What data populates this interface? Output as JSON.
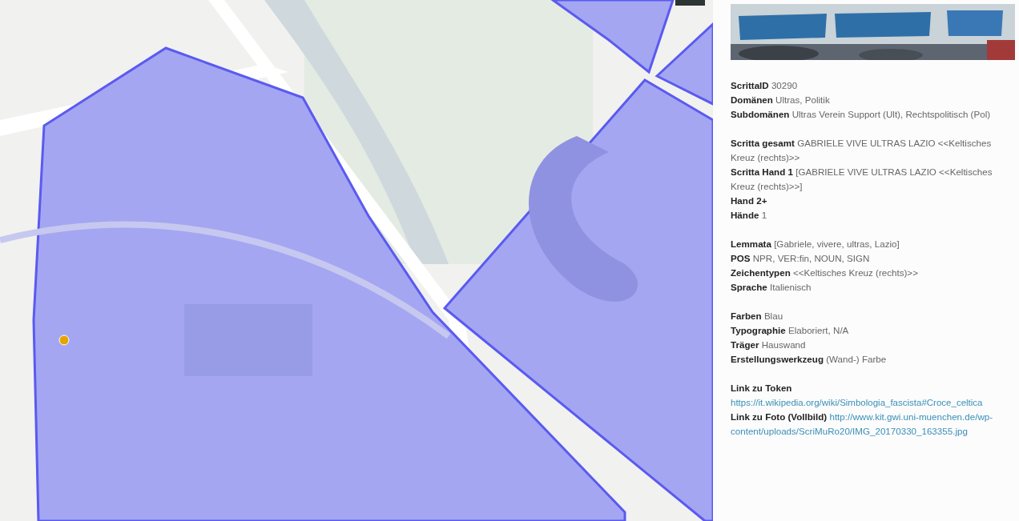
{
  "groups": [
    {
      "fields": [
        {
          "kind": "text",
          "label": "ScrittaID",
          "value": "30290"
        },
        {
          "kind": "text",
          "label": "Domänen",
          "value": "Ultras, Politik"
        },
        {
          "kind": "text",
          "label": "Subdomänen",
          "value": "Ultras Verein Support (Ult), Rechtspolitisch (Pol)"
        }
      ]
    },
    {
      "fields": [
        {
          "kind": "text",
          "label": "Scritta gesamt",
          "value": "GABRIELE VIVE ULTRAS LAZIO <<Keltisches Kreuz (rechts)>>"
        },
        {
          "kind": "text",
          "label": "Scritta Hand 1",
          "value": "[GABRIELE VIVE ULTRAS LAZIO <<Keltisches Kreuz (rechts)>>]"
        },
        {
          "kind": "text",
          "label": "Hand 2+"
        },
        {
          "kind": "text",
          "label": "Hände",
          "value": "1"
        }
      ]
    },
    {
      "fields": [
        {
          "kind": "text",
          "label": "Lemmata",
          "value": "[Gabriele, vivere, ultras, Lazio]"
        },
        {
          "kind": "text",
          "label": "POS",
          "value": "NPR, VER:fin, NOUN, SIGN"
        },
        {
          "kind": "text",
          "label": "Zeichentypen",
          "value": "<<Keltisches Kreuz (rechts)>>"
        },
        {
          "kind": "text",
          "label": "Sprache",
          "value": "Italienisch"
        }
      ]
    },
    {
      "fields": [
        {
          "kind": "text",
          "label": "Farben",
          "value": "Blau"
        },
        {
          "kind": "text",
          "label": "Typographie",
          "value": "Elaboriert, N/A"
        },
        {
          "kind": "text",
          "label": "Träger",
          "value": "Hauswand"
        },
        {
          "kind": "text",
          "label": "Erstellungswerkzeug",
          "value": "(Wand-) Farbe"
        }
      ]
    },
    {
      "fields": [
        {
          "kind": "link_block",
          "label": "Link zu Token",
          "value": "https://it.wikipedia.org/wiki/Simbologia_fascista#Croce_celtica"
        },
        {
          "kind": "link",
          "label": "Link zu Foto (Vollbild)",
          "value": "http://www.kit.gwi.uni-muenchen.de/wp-content/uploads/ScriMuRo20/IMG_20170330_163355.jpg"
        }
      ]
    }
  ]
}
